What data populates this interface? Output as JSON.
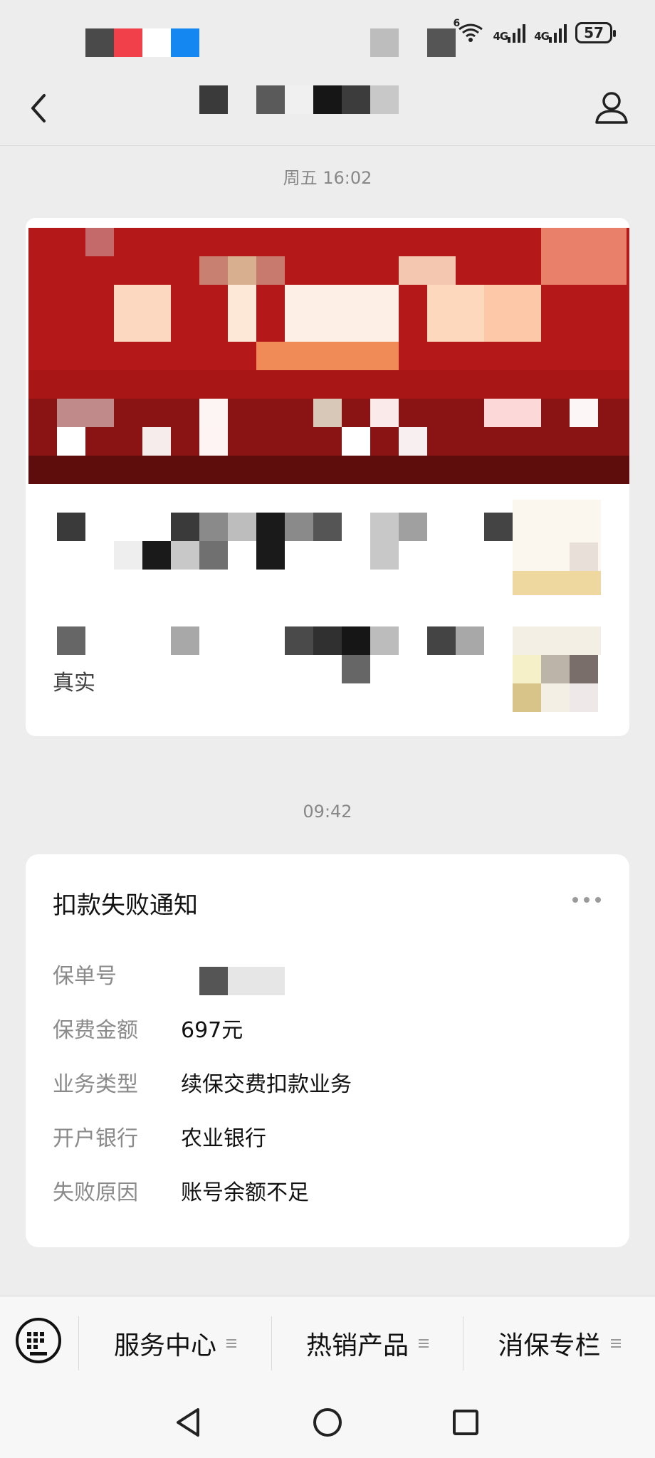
{
  "status_bar": {
    "battery": "57",
    "network_1": "4G",
    "network_2": "4G",
    "wifi_badge": "6"
  },
  "nav": {
    "back_icon": "chevron-left-icon",
    "profile_icon": "person-icon"
  },
  "chat": {
    "timestamp_1": "周五 16:02",
    "article_card": {
      "visible_fragment": "真实"
    },
    "timestamp_2": "09:42",
    "notice_card": {
      "title": "扣款失败通知",
      "more_icon": "more-dots-icon",
      "rows": [
        {
          "label": "保单号",
          "value": ""
        },
        {
          "label": "保费金额",
          "value": "697元"
        },
        {
          "label": "业务类型",
          "value": "续保交费扣款业务"
        },
        {
          "label": "开户银行",
          "value": "农业银行"
        },
        {
          "label": "失败原因",
          "value": "账号余额不足"
        }
      ]
    }
  },
  "bottom_menu": {
    "keyboard_icon": "keyboard-icon",
    "items": [
      {
        "label": "服务中心"
      },
      {
        "label": "热销产品"
      },
      {
        "label": "消保专栏"
      }
    ]
  },
  "system_nav": {
    "back": "triangle-back-icon",
    "home": "circle-home-icon",
    "recents": "square-recents-icon"
  },
  "colors": {
    "banner_red": "#b41818",
    "background": "#ededed",
    "label_gray": "#8a8a8a"
  }
}
